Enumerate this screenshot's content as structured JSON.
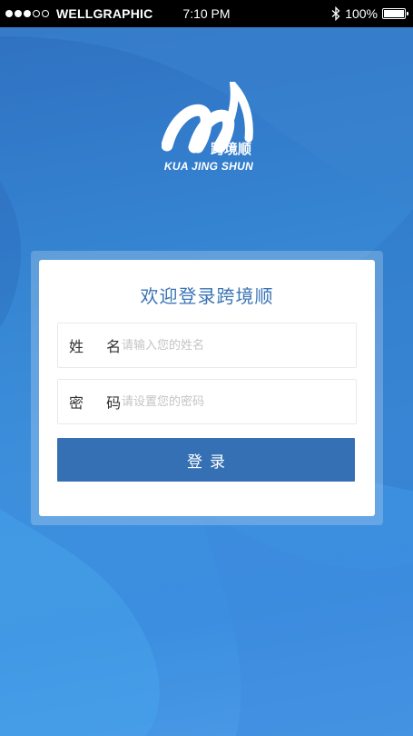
{
  "status_bar": {
    "carrier": "WELLGRAPHIC",
    "time": "7:10 PM",
    "battery_percent": "100%",
    "battery_level": 1.0,
    "signal_bars": 3,
    "signal_total": 5,
    "icons": [
      "signal-icon",
      "bluetooth-icon",
      "battery-icon"
    ]
  },
  "logo": {
    "brand_cn": "跨境顺",
    "brand_en": "KUA JING SHUN"
  },
  "login": {
    "title": "欢迎登录跨境顺",
    "name_label": "姓  名",
    "name_placeholder": "请输入您的姓名",
    "password_label": "密  码",
    "password_placeholder": "请设置您的密码",
    "submit_label": "登录"
  },
  "colors": {
    "primary": "#3670b4",
    "title": "#3a74b5",
    "background": "#3585d2"
  }
}
